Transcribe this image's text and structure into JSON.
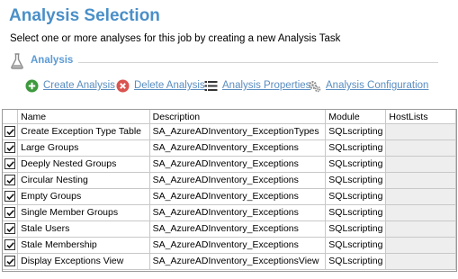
{
  "page": {
    "title": "Analysis Selection",
    "subtitle": "Select one or more analyses for this job by creating a new Analysis Task"
  },
  "section": {
    "title": "Analysis",
    "icon": "flask-icon"
  },
  "toolbar": {
    "create_label": "Create Analysis",
    "delete_label": "Delete Analysis",
    "properties_label": "Analysis Properties",
    "configuration_label": "Analysis Configuration",
    "icons": {
      "create": "plus-circle-icon",
      "delete": "x-circle-icon",
      "properties": "list-icon",
      "configuration": "gears-icon"
    }
  },
  "colors": {
    "title": "#4a8fc8",
    "link": "#5a8dc0",
    "create_icon": "#3c9a3c",
    "delete_icon": "#d9534f"
  },
  "table": {
    "columns": [
      "",
      "Name",
      "Description",
      "Module",
      "HostLists"
    ],
    "rows": [
      {
        "checked": true,
        "name": "Create Exception Type Table",
        "description": "SA_AzureADInventory_ExceptionTypes",
        "module": "SQLscripting",
        "hostlists": ""
      },
      {
        "checked": true,
        "name": "Large Groups",
        "description": "SA_AzureADInventory_Exceptions",
        "module": "SQLscripting",
        "hostlists": ""
      },
      {
        "checked": true,
        "name": "Deeply Nested Groups",
        "description": "SA_AzureADInventory_Exceptions",
        "module": "SQLscripting",
        "hostlists": ""
      },
      {
        "checked": true,
        "name": "Circular Nesting",
        "description": "SA_AzureADInventory_Exceptions",
        "module": "SQLscripting",
        "hostlists": ""
      },
      {
        "checked": true,
        "name": "Empty Groups",
        "description": "SA_AzureADInventory_Exceptions",
        "module": "SQLscripting",
        "hostlists": ""
      },
      {
        "checked": true,
        "name": "Single Member Groups",
        "description": "SA_AzureADInventory_Exceptions",
        "module": "SQLscripting",
        "hostlists": ""
      },
      {
        "checked": true,
        "name": "Stale Users",
        "description": "SA_AzureADInventory_Exceptions",
        "module": "SQLscripting",
        "hostlists": ""
      },
      {
        "checked": true,
        "name": "Stale Membership",
        "description": "SA_AzureADInventory_Exceptions",
        "module": "SQLscripting",
        "hostlists": ""
      },
      {
        "checked": true,
        "name": "Display Exceptions View",
        "description": "SA_AzureADInventory_ExceptionsView",
        "module": "SQLscripting",
        "hostlists": ""
      }
    ]
  }
}
